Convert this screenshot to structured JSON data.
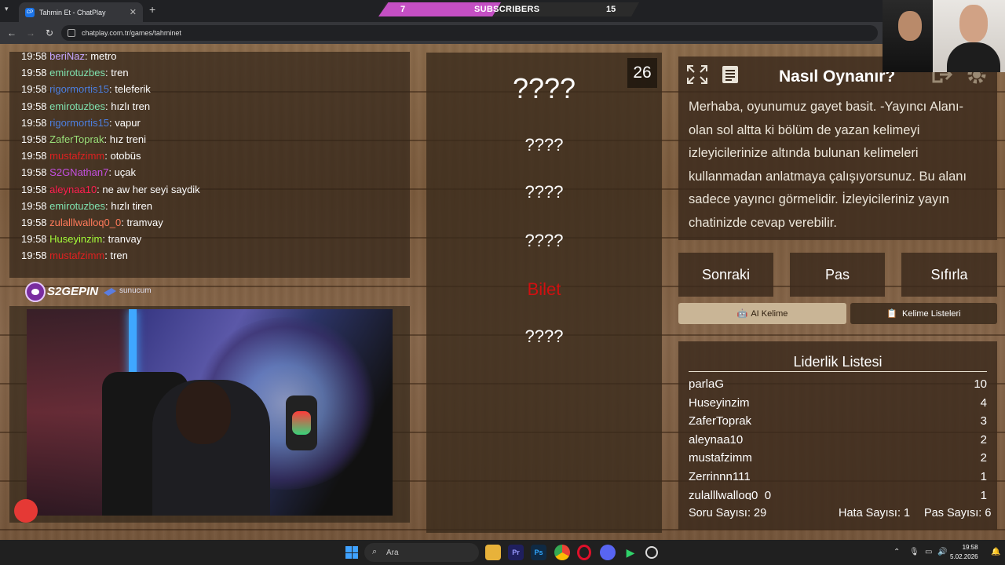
{
  "browser": {
    "tab_title": "Tahmin Et - ChatPlay",
    "tab_favicon": "CP",
    "url": "chatplay.com.tr/games/tahminet"
  },
  "subscriber_bar": {
    "current": "7",
    "label": "SUBSCRIBERS",
    "goal": "15",
    "progress": 0.47,
    "fill_color": "#c44fc4"
  },
  "chat": {
    "messages": [
      {
        "time": "19:58",
        "user": "beriNaz",
        "text": "metro",
        "color": "#c6a6ff"
      },
      {
        "time": "19:58",
        "user": "emirotuzbes",
        "text": "tren",
        "color": "#7fe3b0"
      },
      {
        "time": "19:58",
        "user": "rigormortis15",
        "text": "teleferik",
        "color": "#4c7fe0"
      },
      {
        "time": "19:58",
        "user": "emirotuzbes",
        "text": "hızlı tren",
        "color": "#7fe3b0"
      },
      {
        "time": "19:58",
        "user": "rigormortis15",
        "text": "vapur",
        "color": "#4c7fe0"
      },
      {
        "time": "19:58",
        "user": "ZaferToprak",
        "text": "hız treni",
        "color": "#9ae07a"
      },
      {
        "time": "19:58",
        "user": "mustafzimm",
        "text": "otobüs",
        "color": "#e02020"
      },
      {
        "time": "19:58",
        "user": "S2GNathan7",
        "text": "uçak",
        "color": "#c44fe0"
      },
      {
        "time": "19:58",
        "user": "aleynaa10",
        "text": "ne aw her seyi saydik",
        "color": "#ff1e50"
      },
      {
        "time": "19:58",
        "user": "emirotuzbes",
        "text": "hızlı tiren",
        "color": "#7fe3b0"
      },
      {
        "time": "19:58",
        "user": "zulalllwalloq0_0",
        "text": "tramvay",
        "color": "#ff7a5a"
      },
      {
        "time": "19:58",
        "user": "Huseyinzim",
        "text": "tranvay",
        "color": "#a6ff3a"
      },
      {
        "time": "19:58",
        "user": "mustafzimm",
        "text": "tren",
        "color": "#e02020"
      }
    ]
  },
  "sponsors": {
    "logo1": "S2GEPIN",
    "logo2": "sunucum"
  },
  "game": {
    "timer": "26",
    "words": [
      "????",
      "????",
      "????",
      "????",
      "Bilet",
      "????"
    ]
  },
  "howto": {
    "title": "Nasıl Oynanır?",
    "text": "Merhaba, oyunumuz gayet basit. -Yayıncı Alanı- olan sol altta ki bölüm de yazan kelimeyi izleyicilerinize altında bulunan kelimeleri kullanmadan anlatmaya çalışıyorsunuz. Bu alanı sadece yayıncı görmelidir. İzleyicileriniz yayın chatinizde cevap verebilir."
  },
  "controls": {
    "next": "Sonraki",
    "pass": "Pas",
    "reset": "Sıfırla",
    "ai_word": "AI Kelime",
    "word_lists": "Kelime Listeleri"
  },
  "leaderboard": {
    "title": "Liderlik Listesi",
    "rows": [
      {
        "name": "parlaG",
        "score": "10"
      },
      {
        "name": "Huseyinzim",
        "score": "4"
      },
      {
        "name": "ZaferToprak",
        "score": "3"
      },
      {
        "name": "aleynaa10",
        "score": "2"
      },
      {
        "name": "mustafzimm",
        "score": "2"
      },
      {
        "name": "Zerrinnn111",
        "score": "1"
      },
      {
        "name": "zulalllwalloq0_0",
        "score": "1"
      }
    ]
  },
  "stats": {
    "questions": "Soru Sayısı: 29",
    "errors": "Hata Sayısı: 1",
    "passes": "Pas Sayısı: 6"
  },
  "taskbar": {
    "search_placeholder": "Ara",
    "time": "19:58",
    "date": "5.02.2026"
  }
}
